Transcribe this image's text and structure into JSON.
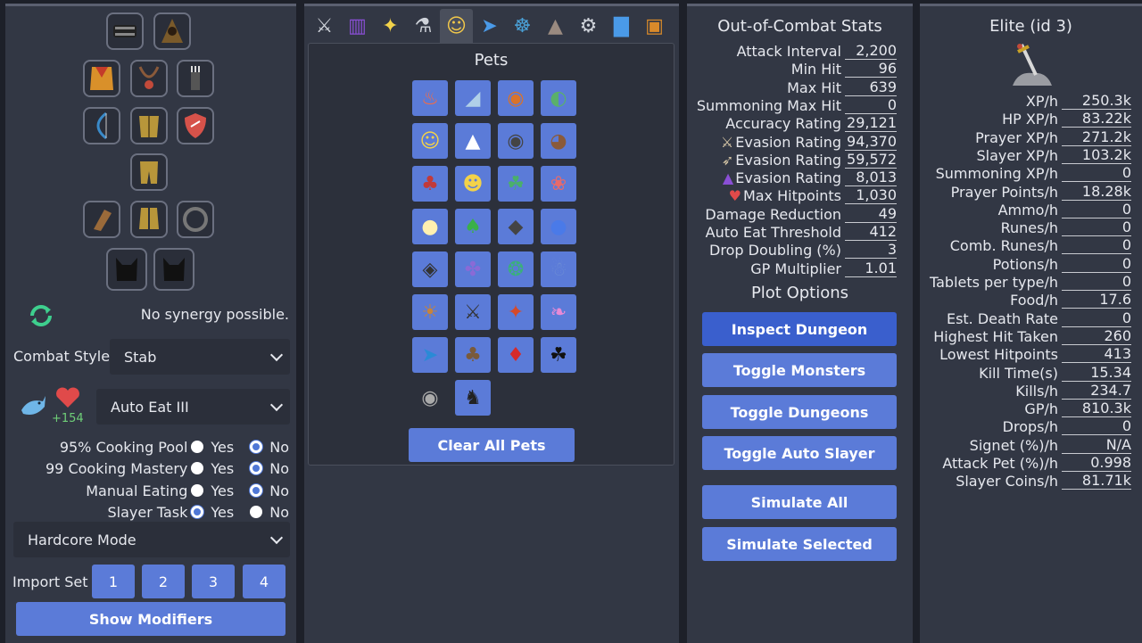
{
  "left": {
    "synergy_text": "No synergy possible.",
    "combat_style_label": "Combat Style",
    "combat_style_value": "Stab",
    "food_bonus": "+154",
    "auto_eat_value": "Auto Eat III",
    "options": [
      {
        "label": "95% Cooking Pool",
        "selected": "No"
      },
      {
        "label": "99 Cooking Mastery",
        "selected": "No"
      },
      {
        "label": "Manual Eating",
        "selected": "No"
      },
      {
        "label": "Slayer Task",
        "selected": "Yes"
      }
    ],
    "yes_label": "Yes",
    "no_label": "No",
    "mode_value": "Hardcore Mode",
    "import_label": "Import Set",
    "import_buttons": [
      "1",
      "2",
      "3",
      "4"
    ],
    "show_modifiers": "Show Modifiers"
  },
  "middle": {
    "tabs": [
      "swords-icon",
      "spellbook-icon",
      "sparkle-icon",
      "potion-icon",
      "cat-icon",
      "runner-icon",
      "wheel-icon",
      "hat-icon",
      "gear-icon",
      "chart-icon",
      "chest-icon"
    ],
    "pets_title": "Pets",
    "clear_button": "Clear All Pets",
    "pets": [
      "fire-spirit",
      "shark",
      "bear",
      "turtle",
      "cat",
      "eagle",
      "owl",
      "monkey",
      "demon",
      "golem",
      "dino",
      "octopus",
      "chick",
      "goblin",
      "goat",
      "slime",
      "beetle",
      "jellyfish",
      "squid",
      "yeti",
      "lion",
      "knight",
      "dragon",
      "axolotl",
      "fish",
      "tree",
      "imp",
      "panther",
      "rat",
      "horse"
    ]
  },
  "ooc": {
    "title": "Out-of-Combat Stats",
    "stats": [
      {
        "label": "Attack Interval",
        "value": "2,200",
        "icon": ""
      },
      {
        "label": "Min Hit",
        "value": "96",
        "icon": ""
      },
      {
        "label": "Max Hit",
        "value": "639",
        "icon": ""
      },
      {
        "label": "Summoning Max Hit",
        "value": "0",
        "icon": ""
      },
      {
        "label": "Accuracy Rating",
        "value": "29,121",
        "icon": ""
      },
      {
        "label": "Evasion Rating",
        "value": "94,370",
        "icon": "sword-icon"
      },
      {
        "label": "Evasion Rating",
        "value": "59,572",
        "icon": "bow-icon"
      },
      {
        "label": "Evasion Rating",
        "value": "8,013",
        "icon": "wizard-hat-icon"
      },
      {
        "label": "Max Hitpoints",
        "value": "1,030",
        "icon": "heart-icon"
      },
      {
        "label": "Damage Reduction",
        "value": "49",
        "icon": ""
      },
      {
        "label": "Auto Eat Threshold",
        "value": "412",
        "icon": ""
      },
      {
        "label": "Drop Doubling (%)",
        "value": "3",
        "icon": ""
      },
      {
        "label": "GP Multiplier",
        "value": "1.01",
        "icon": ""
      }
    ],
    "plot_title": "Plot Options",
    "buttons": [
      "Inspect Dungeon",
      "Toggle Monsters",
      "Toggle Dungeons",
      "Toggle Auto Slayer",
      "Simulate All",
      "Simulate Selected"
    ]
  },
  "elite": {
    "title": "Elite (id 3)",
    "stats": [
      {
        "label": "XP/h",
        "value": "250.3k"
      },
      {
        "label": "HP XP/h",
        "value": "83.22k"
      },
      {
        "label": "Prayer XP/h",
        "value": "271.2k"
      },
      {
        "label": "Slayer XP/h",
        "value": "103.2k"
      },
      {
        "label": "Summoning XP/h",
        "value": "0"
      },
      {
        "label": "Prayer Points/h",
        "value": "18.28k"
      },
      {
        "label": "Ammo/h",
        "value": "0"
      },
      {
        "label": "Runes/h",
        "value": "0"
      },
      {
        "label": "Comb. Runes/h",
        "value": "0"
      },
      {
        "label": "Potions/h",
        "value": "0"
      },
      {
        "label": "Tablets per type/h",
        "value": "0"
      },
      {
        "label": "Food/h",
        "value": "17.6"
      },
      {
        "label": "Est. Death Rate",
        "value": "0"
      },
      {
        "label": "Highest Hit Taken",
        "value": "260"
      },
      {
        "label": "Lowest Hitpoints",
        "value": "413"
      },
      {
        "label": "Kill Time(s)",
        "value": "15.34"
      },
      {
        "label": "Kills/h",
        "value": "234.7"
      },
      {
        "label": "GP/h",
        "value": "810.3k"
      },
      {
        "label": "Drops/h",
        "value": "0"
      },
      {
        "label": "Signet (%)/h",
        "value": "N/A"
      },
      {
        "label": "Attack Pet (%)/h",
        "value": "0.998"
      },
      {
        "label": "Slayer Coins/h",
        "value": "81.71k"
      }
    ]
  }
}
